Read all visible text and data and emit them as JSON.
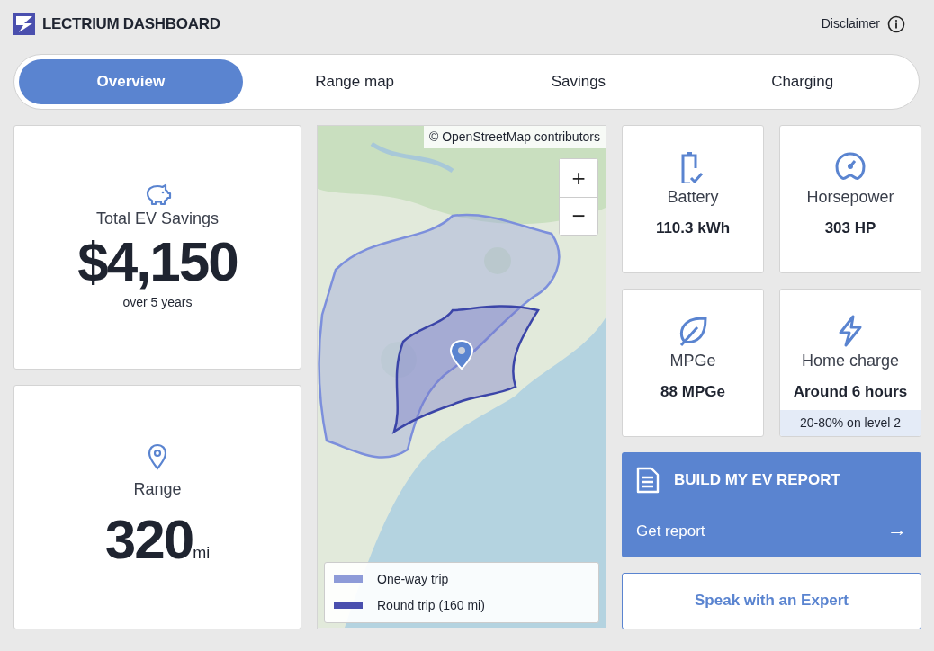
{
  "header": {
    "title": "LECTRIUM DASHBOARD",
    "disclaimer": "Disclaimer"
  },
  "tabs": [
    {
      "label": "Overview",
      "selected": true
    },
    {
      "label": "Range map",
      "selected": false
    },
    {
      "label": "Savings",
      "selected": false
    },
    {
      "label": "Charging",
      "selected": false
    }
  ],
  "savings": {
    "label": "Total EV Savings",
    "value": "$4,150",
    "note": "over 5 years"
  },
  "range": {
    "label": "Range",
    "value": "320",
    "unit": "mi"
  },
  "map": {
    "attribution": "© OpenStreetMap contributors",
    "zoom_in": "+",
    "zoom_out": "−",
    "legend": [
      {
        "label": "One-way trip",
        "color": "#8e9bd8"
      },
      {
        "label": "Round trip (160 mi)",
        "color": "#4a4fae"
      }
    ]
  },
  "stats": [
    {
      "kind": "battery",
      "label": "Battery",
      "value": "110.3 kWh"
    },
    {
      "kind": "speed",
      "label": "Horsepower",
      "value": "303 HP"
    },
    {
      "kind": "leaf",
      "label": "MPGe",
      "value": "88 MPGe"
    },
    {
      "kind": "bolt",
      "label": "Home charge",
      "value": "Around 6 hours",
      "note": "20-80% on level 2"
    }
  ],
  "report": {
    "title": "BUILD MY EV REPORT",
    "action": "Get report",
    "arrow": "→"
  },
  "expert_button": "Speak with an Expert"
}
